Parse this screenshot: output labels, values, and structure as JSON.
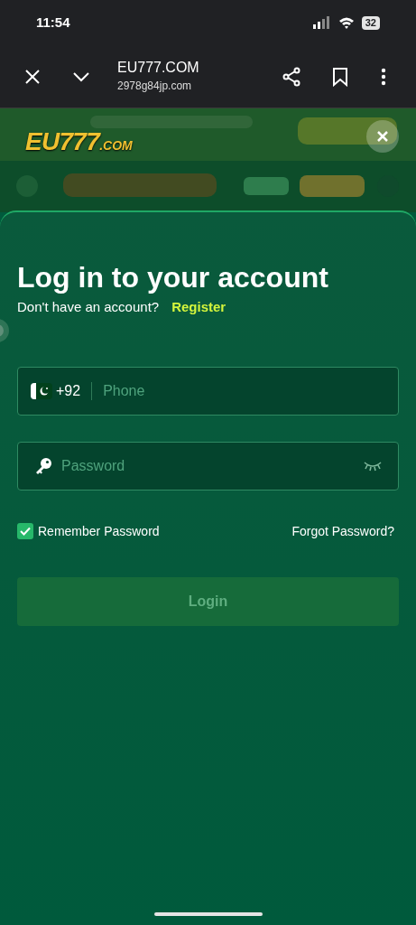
{
  "status_bar": {
    "time": "11:54",
    "battery": "32"
  },
  "browser_bar": {
    "title": "EU777.COM",
    "url": "2978g84jp.com"
  },
  "banner": {
    "logo_main": "EU777",
    "logo_suffix": ".COM"
  },
  "login": {
    "title": "Log in to your account",
    "prompt": "Don't have an account?",
    "register_link": "Register",
    "phone": {
      "code": "+92",
      "placeholder": "Phone"
    },
    "password": {
      "placeholder": "Password",
      "visible": false
    },
    "remember": {
      "label": "Remember Password",
      "checked": true
    },
    "forgot_link": "Forgot Password?",
    "login_button": {
      "label": "Login",
      "disabled": true
    }
  }
}
